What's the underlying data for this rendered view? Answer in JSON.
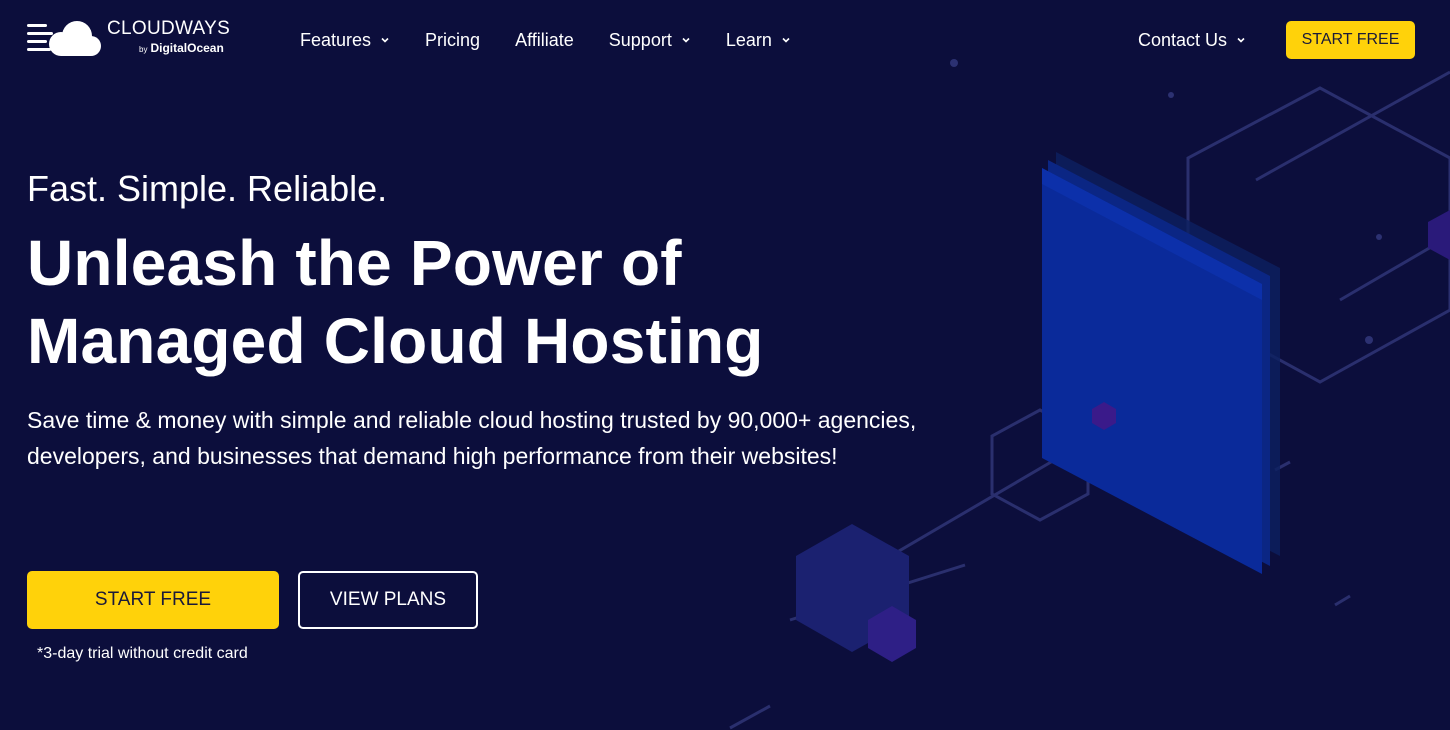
{
  "brand": {
    "name": "CLOUDWAYS",
    "by": "by",
    "partner": "DigitalOcean"
  },
  "nav": {
    "items": [
      {
        "label": "Features",
        "dropdown": true
      },
      {
        "label": "Pricing",
        "dropdown": false
      },
      {
        "label": "Affiliate",
        "dropdown": false
      },
      {
        "label": "Support",
        "dropdown": true
      },
      {
        "label": "Learn",
        "dropdown": true
      }
    ],
    "contact_label": "Contact Us",
    "start_free_label": "START FREE"
  },
  "hero": {
    "tagline": "Fast. Simple. Reliable.",
    "headline_line1": "Unleash the Power of",
    "headline_line2": "Managed Cloud Hosting",
    "description": "Save time & money with simple and reliable cloud hosting trusted by 90,000+ agencies, developers, and businesses that demand high performance from their websites!",
    "primary_cta": "START FREE",
    "secondary_cta": "VIEW PLANS",
    "trial_note": "*3-day trial without credit card"
  },
  "colors": {
    "background": "#0c0e3c",
    "accent": "#ffd20a",
    "panel_blue": "#0a2a9a"
  },
  "icons": {
    "logo": "cloud-logo-icon",
    "dropdown": "chevron-down-icon"
  }
}
